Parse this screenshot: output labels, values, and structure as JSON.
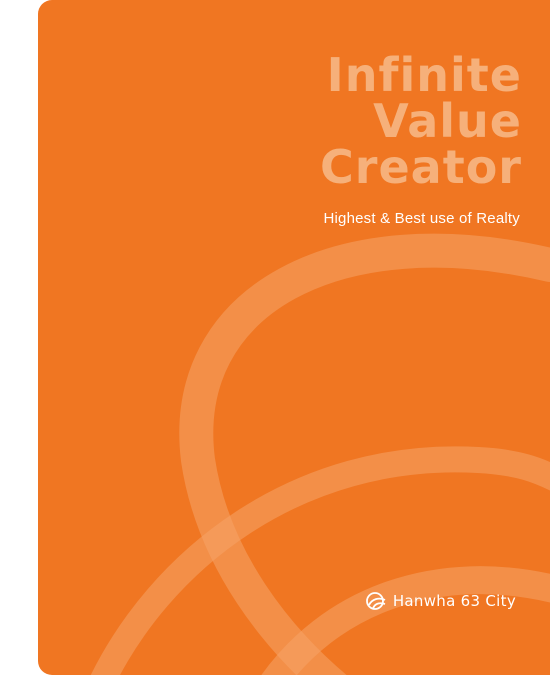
{
  "cover": {
    "headline": [
      "Infinite",
      "Value",
      "Creator"
    ],
    "tagline": "Highest & Best use of Realty",
    "brand": "Hanwha 63 City"
  },
  "colors": {
    "background": "#f07622",
    "headline": "#f6b07a",
    "swirl": "#f5a468",
    "text": "#ffffff"
  },
  "icons": {
    "logo": "hanwha-trinity-circle-icon"
  }
}
